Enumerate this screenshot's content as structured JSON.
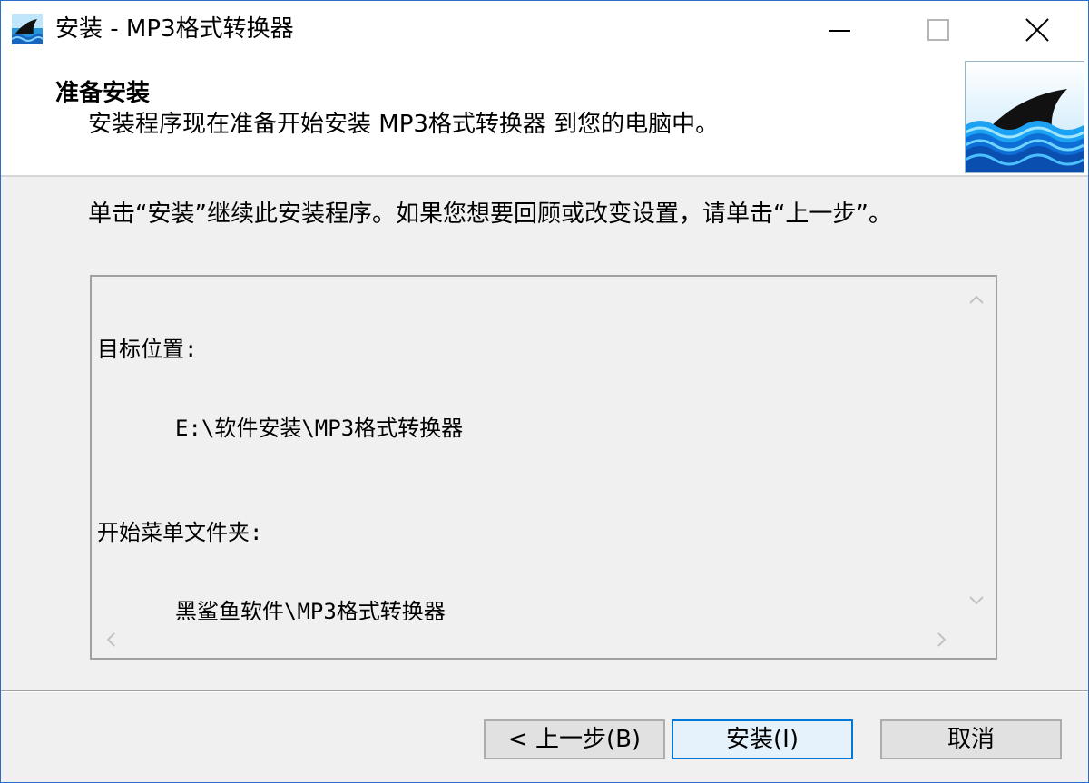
{
  "window": {
    "title": "安装 - MP3格式转换器",
    "controls": [
      "minimize",
      "maximize",
      "close"
    ]
  },
  "header": {
    "title": "准备安装",
    "subtitle": "安装程序现在准备开始安装 MP3格式转换器 到您的电脑中。",
    "image_icon": "shark-fin-icon"
  },
  "body": {
    "instruction": "单击“安装”继续此安装程序。如果您想要回顾或改变设置，请单击“上一步”。",
    "memo": {
      "dest_label": "目标位置:",
      "dest_value": "E:\\软件安装\\MP3格式转换器",
      "menu_label": "开始菜单文件夹:",
      "menu_value": "黑鲨鱼软件\\MP3格式转换器"
    }
  },
  "buttons": {
    "back": "< 上一步(B)",
    "install": "安装(I)",
    "cancel": "取消"
  },
  "colors": {
    "window_border": "#2b6cc4",
    "default_button_border": "#0078d7",
    "default_button_bg": "#e5f1fb",
    "face": "#f0f0f0"
  }
}
